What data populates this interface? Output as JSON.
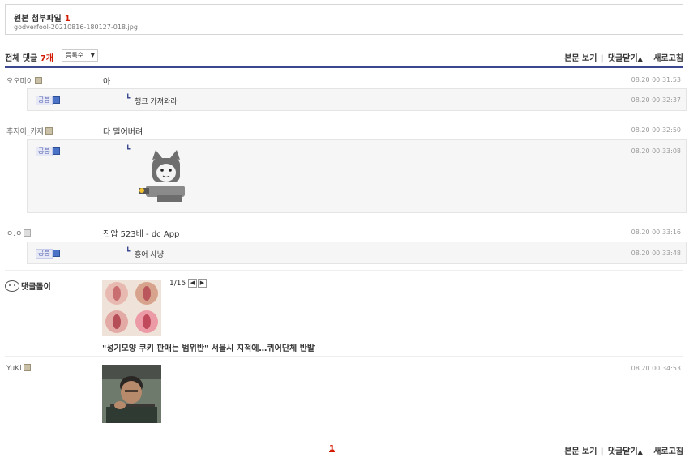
{
  "attachment": {
    "title": "원본 첨부파일",
    "count": "1",
    "filename": "godverfool-20210816-180127-018.jpg"
  },
  "comments_header": {
    "total_label": "전체 댓글",
    "total_count": "7개",
    "sort": "등록순",
    "view_post": "본문 보기",
    "close_comments": "댓글닫기",
    "refresh": "새로고침"
  },
  "comments": [
    {
      "nick": "오오미이",
      "text": "아",
      "date": "08.20 00:31:53",
      "reply": {
        "nick": "공붕",
        "text": "행크 가져와라",
        "date": "08.20 00:32:37"
      }
    },
    {
      "nick": "후지이_카제",
      "text": "다 밀어버려",
      "date": "08.20 00:32:50",
      "reply": {
        "nick": "공붕",
        "date": "08.20 00:33:08"
      }
    },
    {
      "nick": "ㅇ.ㅇ",
      "text": "진압 523배 - dc App",
      "date": "08.20 00:33:16",
      "reply": {
        "nick": "공붕",
        "text": "홍어 사냥",
        "date": "08.20 00:33:48"
      }
    }
  ],
  "ad": {
    "label": "댓글돌이",
    "pager": "1/15",
    "prev": "◀",
    "next": "▶",
    "headline": "\"성기모양 쿠키 판매는 범위반\" 서울시 지적에…퀴어단체 반발"
  },
  "last_comment": {
    "nick": "YuKi",
    "date": "08.20 00:34:53"
  },
  "footer": {
    "page": "1",
    "view_post": "본문 보기",
    "close_comments": "댓글닫기",
    "refresh": "새로고침"
  },
  "icons": {
    "up_triangle": "▲",
    "down_triangle": "▼",
    "reply_arrow": "┗"
  },
  "colors": {
    "accent_red": "#d31900",
    "accent_blue": "#3b4890"
  }
}
